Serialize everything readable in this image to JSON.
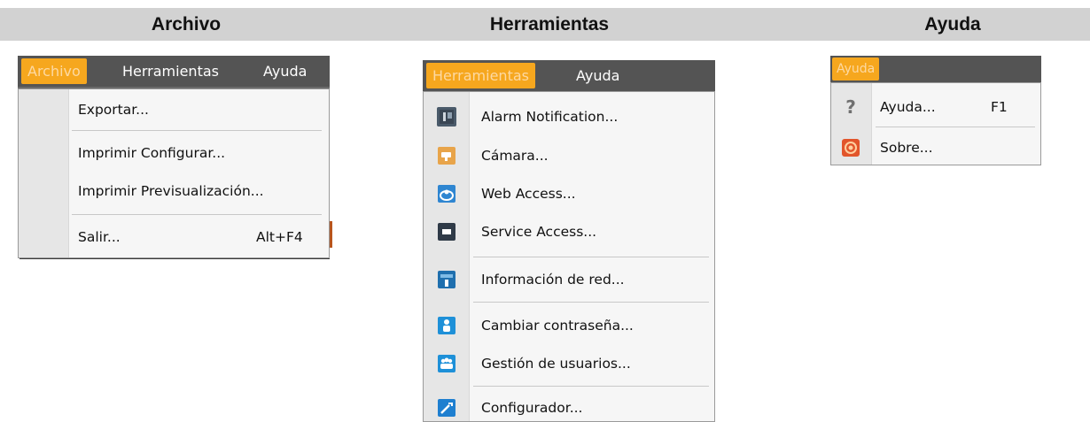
{
  "columns": {
    "archivo": "Archivo",
    "herramientas": "Herramientas",
    "ayuda": "Ayuda"
  },
  "archivo_panel": {
    "menubar": [
      "Archivo",
      "Herramientas",
      "Ayuda"
    ],
    "items": [
      {
        "label": "Exportar..."
      },
      {
        "label": "Imprimir Configurar..."
      },
      {
        "label": "Imprimir Previsualización..."
      },
      {
        "label": "Salir...",
        "shortcut": "Alt+F4"
      }
    ]
  },
  "herramientas_panel": {
    "menubar": [
      "Herramientas",
      "Ayuda"
    ],
    "items": [
      {
        "label": "Alarm Notification...",
        "icon": "alarm-notification-icon"
      },
      {
        "label": "Cámara...",
        "icon": "camera-icon"
      },
      {
        "label": "Web Access...",
        "icon": "web-access-icon"
      },
      {
        "label": "Service Access...",
        "icon": "service-access-icon"
      },
      {
        "label": "Información de red...",
        "icon": "network-info-icon"
      },
      {
        "label": "Cambiar contraseña...",
        "icon": "user-icon"
      },
      {
        "label": "Gestión de usuarios...",
        "icon": "users-icon"
      },
      {
        "label": "Configurador...",
        "icon": "wrench-icon"
      }
    ]
  },
  "ayuda_panel": {
    "menubar": [
      "Ayuda"
    ],
    "items": [
      {
        "label": "Ayuda...",
        "shortcut": "F1",
        "icon": "help-icon"
      },
      {
        "label": "Sobre...",
        "icon": "about-icon"
      }
    ]
  },
  "colors": {
    "menubar": "#545454",
    "active_menu": "#f6a71e",
    "header_band": "#d2d2d2"
  }
}
